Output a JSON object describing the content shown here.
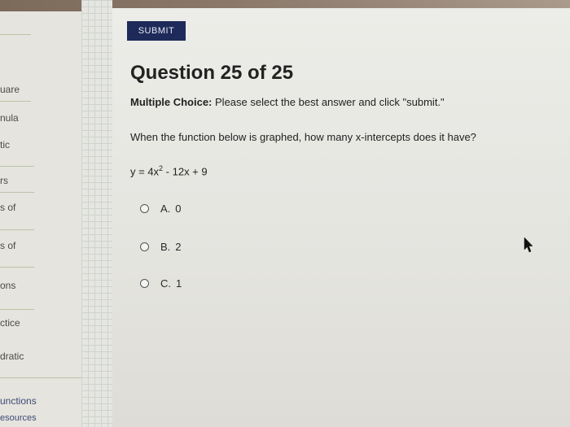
{
  "sidebar": {
    "items": [
      {
        "label": "uare"
      },
      {
        "label": "nula"
      },
      {
        "label": "tic"
      },
      {
        "label": "rs"
      },
      {
        "label": "s of"
      },
      {
        "label": "s of"
      },
      {
        "label": "ons"
      },
      {
        "label": "ctice"
      },
      {
        "label": "dratic"
      },
      {
        "label": "unctions"
      },
      {
        "label": "esources"
      }
    ]
  },
  "main": {
    "submit_label": "SUBMIT",
    "title": "Question 25 of 25",
    "instructions_prefix": "Multiple Choice:",
    "instructions_text": "Please select the best answer and click \"submit.\"",
    "question": "When the function below is graphed, how many x-intercepts does it have?",
    "equation": {
      "lhs": "y = 4x",
      "exponent": "2",
      "rest": " - 12x + 9"
    },
    "choices": [
      {
        "letter": "A.",
        "value": "0"
      },
      {
        "letter": "B.",
        "value": "2"
      },
      {
        "letter": "C.",
        "value": "1"
      }
    ]
  },
  "colors": {
    "submit_bg": "#1e2a5a",
    "text": "#222222"
  }
}
